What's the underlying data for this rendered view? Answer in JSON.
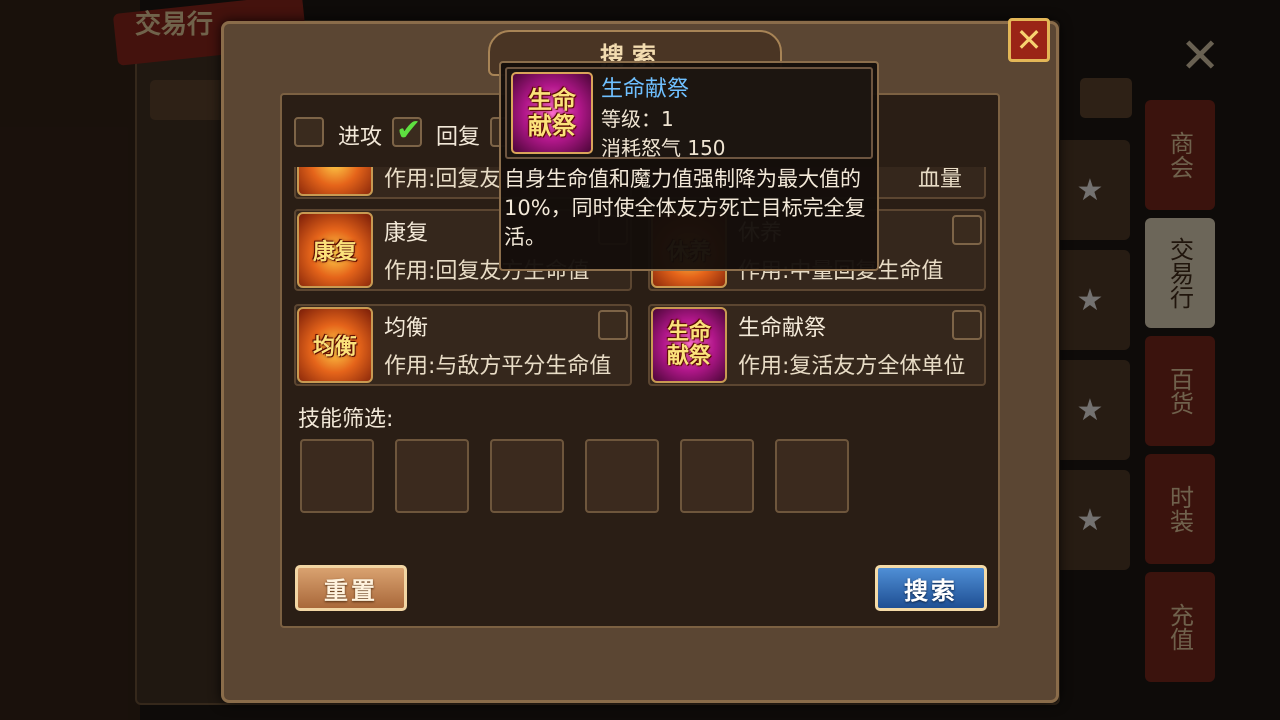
{
  "background": {
    "title": "交易行",
    "right_tabs": [
      "商会",
      "交易行",
      "百货",
      "时装",
      "充值"
    ],
    "bottom_reset": "重置",
    "bottom_search": "搜索"
  },
  "window": {
    "title": "搜索",
    "close_icon": "close-icon"
  },
  "filters": {
    "attack_label": "进攻",
    "attack_checked": false,
    "heal_label": "回复",
    "heal_checked": true
  },
  "skills": [
    {
      "name": "康复",
      "icon_text": "康复",
      "desc": "作用:回复友方生命值",
      "checked": false
    },
    {
      "name": "休养",
      "icon_text": "休养",
      "desc": "作用:中量回复生命值",
      "checked": false
    },
    {
      "name": "均衡",
      "icon_text": "均衡",
      "desc": "作用:与敌方平分生命值",
      "checked": false
    },
    {
      "name": "生命献祭",
      "icon_text": "生命献祭",
      "desc": "作用:复活友方全体单位",
      "checked": false
    }
  ],
  "partial_row": {
    "desc_left": "作用:回复友",
    "desc_right": "血量"
  },
  "skill_filter_label": "技能筛选:",
  "slot_count": 6,
  "buttons": {
    "reset": "重置",
    "search": "搜索"
  },
  "tooltip": {
    "icon_text": "生命献祭",
    "name": "生命献祭",
    "level": "等级：1",
    "cost": "消耗怒气 150",
    "description": "自身生命值和魔力值强制降为最大值的10%，同时使全体友方死亡目标完全复活。"
  },
  "colors": {
    "panel": "#2a1e15",
    "accent_gold": "#c89a52",
    "tooltip_name": "#6fc0ff",
    "check_green": "#5ee040",
    "search_blue": "#1f4f93",
    "reset_orange": "#a9683a"
  }
}
